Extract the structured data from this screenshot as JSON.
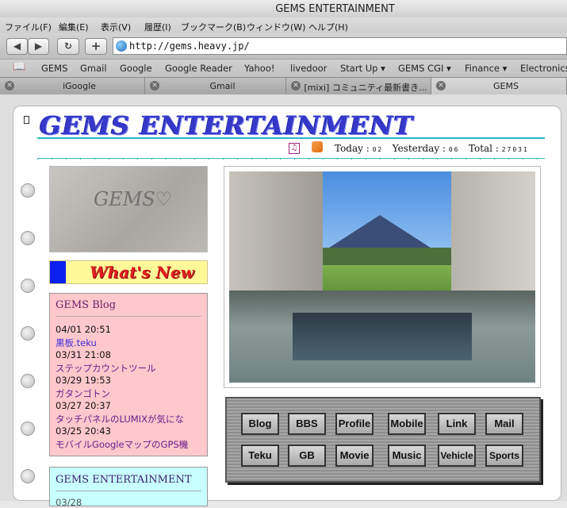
{
  "window": {
    "title": "GEMS ENTERTAINMENT"
  },
  "menubar": [
    "ファイル(F)",
    "編集(E)",
    "表示(V)",
    "履歴(I)",
    "ブックマーク(B)",
    "ウィンドウ(W)",
    "ヘルプ(H)"
  ],
  "toolbar": {
    "back": "◀",
    "forward": "▶",
    "reload": "↻",
    "add": "+",
    "url": "http://gems.heavy.jp/"
  },
  "bookmarks": [
    "GEMS",
    "Gmail",
    "Google",
    "Google Reader",
    "Yahoo!",
    "livedoor",
    "Start Up ▾",
    "GEMS CGI ▾",
    "Finance ▾",
    "Electronics"
  ],
  "tabs": [
    {
      "label": "iGoogle",
      "active": false
    },
    {
      "label": "Gmail",
      "active": false
    },
    {
      "label": "[mixi] コミュニティ最新書き...",
      "active": false
    },
    {
      "label": "GEMS",
      "active": true
    }
  ],
  "page": {
    "logo": "GEMS ENTERTAINMENT",
    "counter": {
      "today_label": "Today :",
      "today": "02",
      "yesterday_label": "Yesterday :",
      "yesterday": "06",
      "total_label": "Total :",
      "total": "27031"
    },
    "photo_scrawl": "GEMS♡",
    "whats_new": "What's New",
    "blog": {
      "title": "GEMS Blog",
      "entries": [
        {
          "date": "04/01 20:51",
          "title": "黒板.teku"
        },
        {
          "date": "03/31 21:08",
          "title": "ステップカウントツール"
        },
        {
          "date": "03/29 19:53",
          "title": "ガタンゴトン"
        },
        {
          "date": "03/27 20:37",
          "title": "タッチパネルのLUMIXが気にな"
        },
        {
          "date": "03/25 20:43",
          "title": "モバイルGoogleマップのGPS機"
        }
      ]
    },
    "gems_box": {
      "title": "GEMS ENTERTAINMENT",
      "partial": "03/28"
    },
    "menu": [
      "Blog",
      "BBS",
      "Profile",
      "Mobile",
      "Link",
      "Mail",
      "Teku",
      "GB",
      "Movie",
      "Music",
      "Vehicle",
      "Sports"
    ]
  }
}
